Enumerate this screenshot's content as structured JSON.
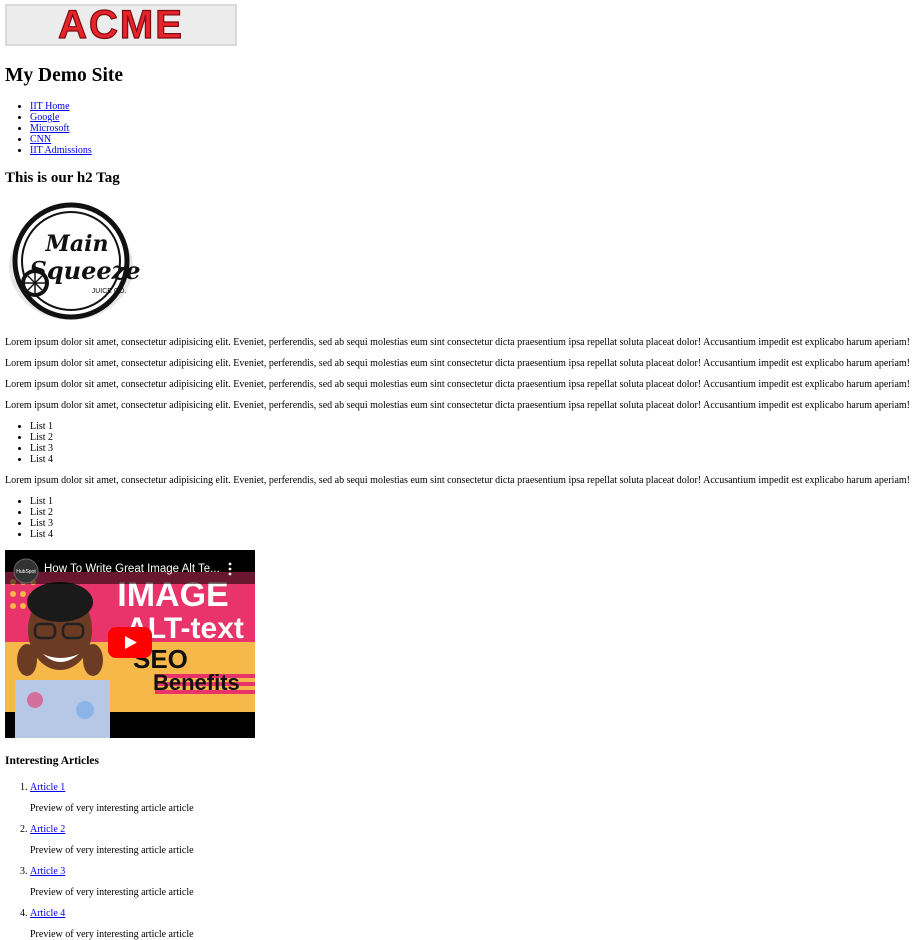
{
  "header": {
    "logo_text": "ACME",
    "site_title": "My Demo Site"
  },
  "nav": {
    "links": [
      {
        "label": "IIT Home"
      },
      {
        "label": "Google"
      },
      {
        "label": "Microsoft"
      },
      {
        "label": "CNN"
      },
      {
        "label": "IIT Admissions"
      }
    ]
  },
  "section": {
    "h2": "This is our h2 Tag",
    "brand_logo_text": "Main Squeeze Juice Co.",
    "paragraph": "Lorem ipsum dolor sit amet, consectetur adipisicing elit. Eveniet, perferendis, sed ab sequi molestias eum sint consectetur dicta praesentium ipsa repellat soluta placeat dolor! Accusantium impedit est explicabo harum aperiam!",
    "list_items": [
      "List 1",
      "List 2",
      "List 3",
      "List 4"
    ]
  },
  "video": {
    "title": "How To Write Great Image Alt Te...",
    "thumb_line1": "IMAGE",
    "thumb_line2": "ALT-text",
    "thumb_line3": "SEO",
    "thumb_line4": "Benefits",
    "channel_avatar_text": "HubSpot",
    "colors": {
      "pink": "#e8336b",
      "yellow": "#f7b84a",
      "play_red": "#ff0000"
    }
  },
  "articles": {
    "heading": "Interesting Articles",
    "items": [
      {
        "title": "Article 1",
        "preview": "Preview of very interesting article article"
      },
      {
        "title": "Article 2",
        "preview": "Preview of very interesting article article"
      },
      {
        "title": "Article 3",
        "preview": "Preview of very interesting article article"
      },
      {
        "title": "Article 4",
        "preview": "Preview of very interesting article article"
      }
    ]
  }
}
